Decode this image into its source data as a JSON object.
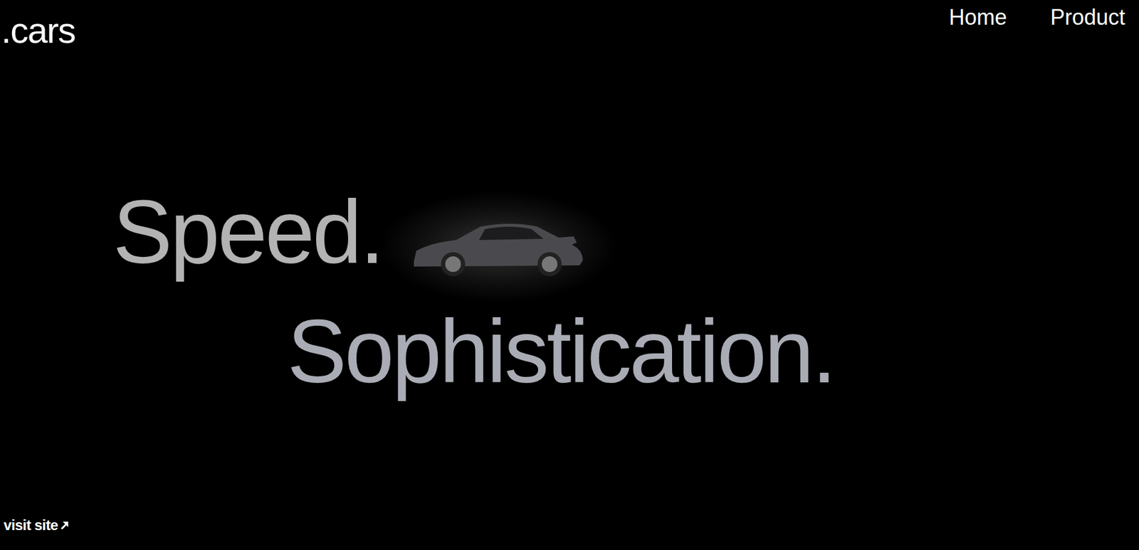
{
  "logo": {
    "text": ".cars"
  },
  "nav": [
    {
      "label": "Home"
    },
    {
      "label": "Product"
    }
  ],
  "hero": {
    "lines": [
      "Speed.",
      "Sophistication."
    ]
  },
  "link": {
    "label": "visit site"
  }
}
